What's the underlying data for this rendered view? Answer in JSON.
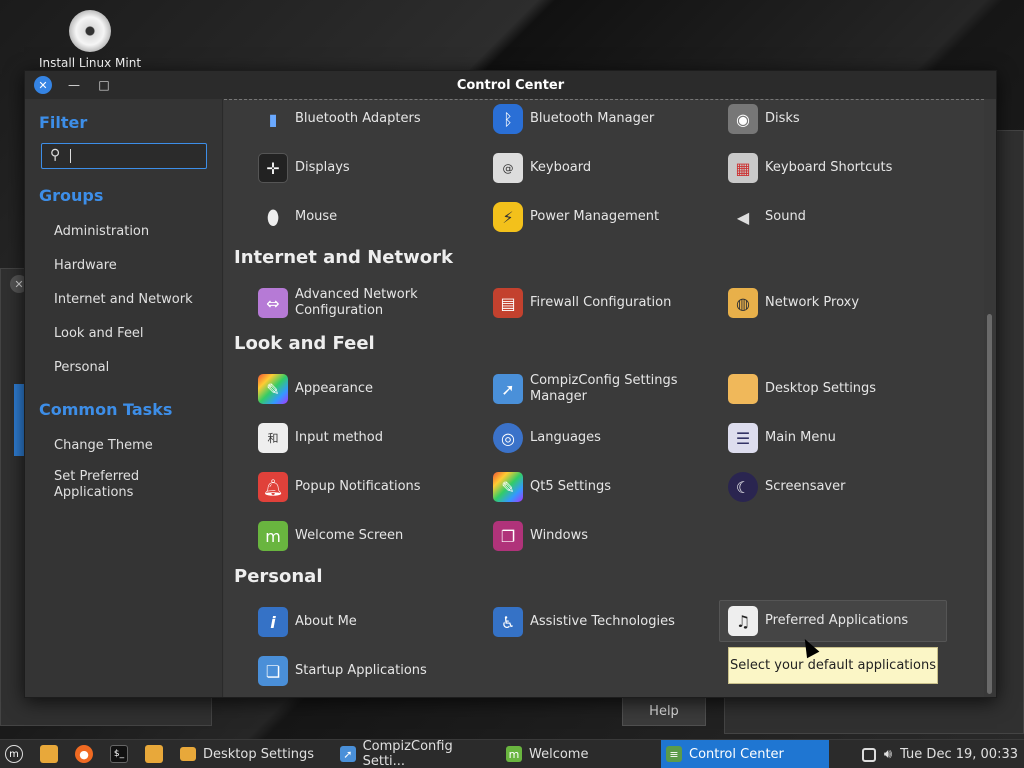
{
  "desktop": {
    "icon_label": "Install Linux Mint"
  },
  "window": {
    "title": "Control Center"
  },
  "sidebar": {
    "filter_heading": "Filter",
    "search_placeholder": "",
    "groups_heading": "Groups",
    "groups": [
      "Administration",
      "Hardware",
      "Internet and Network",
      "Look and Feel",
      "Personal"
    ],
    "tasks_heading": "Common Tasks",
    "tasks": [
      "Change Theme",
      "Set Preferred Applications"
    ]
  },
  "sections": {
    "hardware_items": [
      "Bluetooth Adapters",
      "Bluetooth Manager",
      "Disks",
      "Displays",
      "Keyboard",
      "Keyboard Shortcuts",
      "Mouse",
      "Power Management",
      "Sound"
    ],
    "internet": {
      "title": "Internet and Network",
      "items": [
        "Advanced Network Configuration",
        "Firewall Configuration",
        "Network Proxy"
      ]
    },
    "look": {
      "title": "Look and Feel",
      "items": [
        "Appearance",
        "CompizConfig Settings Manager",
        "Desktop Settings",
        "Input method",
        "Languages",
        "Main Menu",
        "Popup Notifications",
        "Qt5 Settings",
        "Screensaver",
        "Welcome Screen",
        "Windows"
      ]
    },
    "personal": {
      "title": "Personal",
      "items": [
        "About Me",
        "Assistive Technologies",
        "Preferred Applications",
        "Startup Applications"
      ]
    }
  },
  "tooltip": "Select your default applications",
  "background_window": {
    "help_label": "Help"
  },
  "taskbar": {
    "tasks": [
      "Desktop Settings",
      "CompizConfig Setti...",
      "Welcome",
      "Control Center"
    ],
    "clock": "Tue Dec 19, 00:33"
  }
}
